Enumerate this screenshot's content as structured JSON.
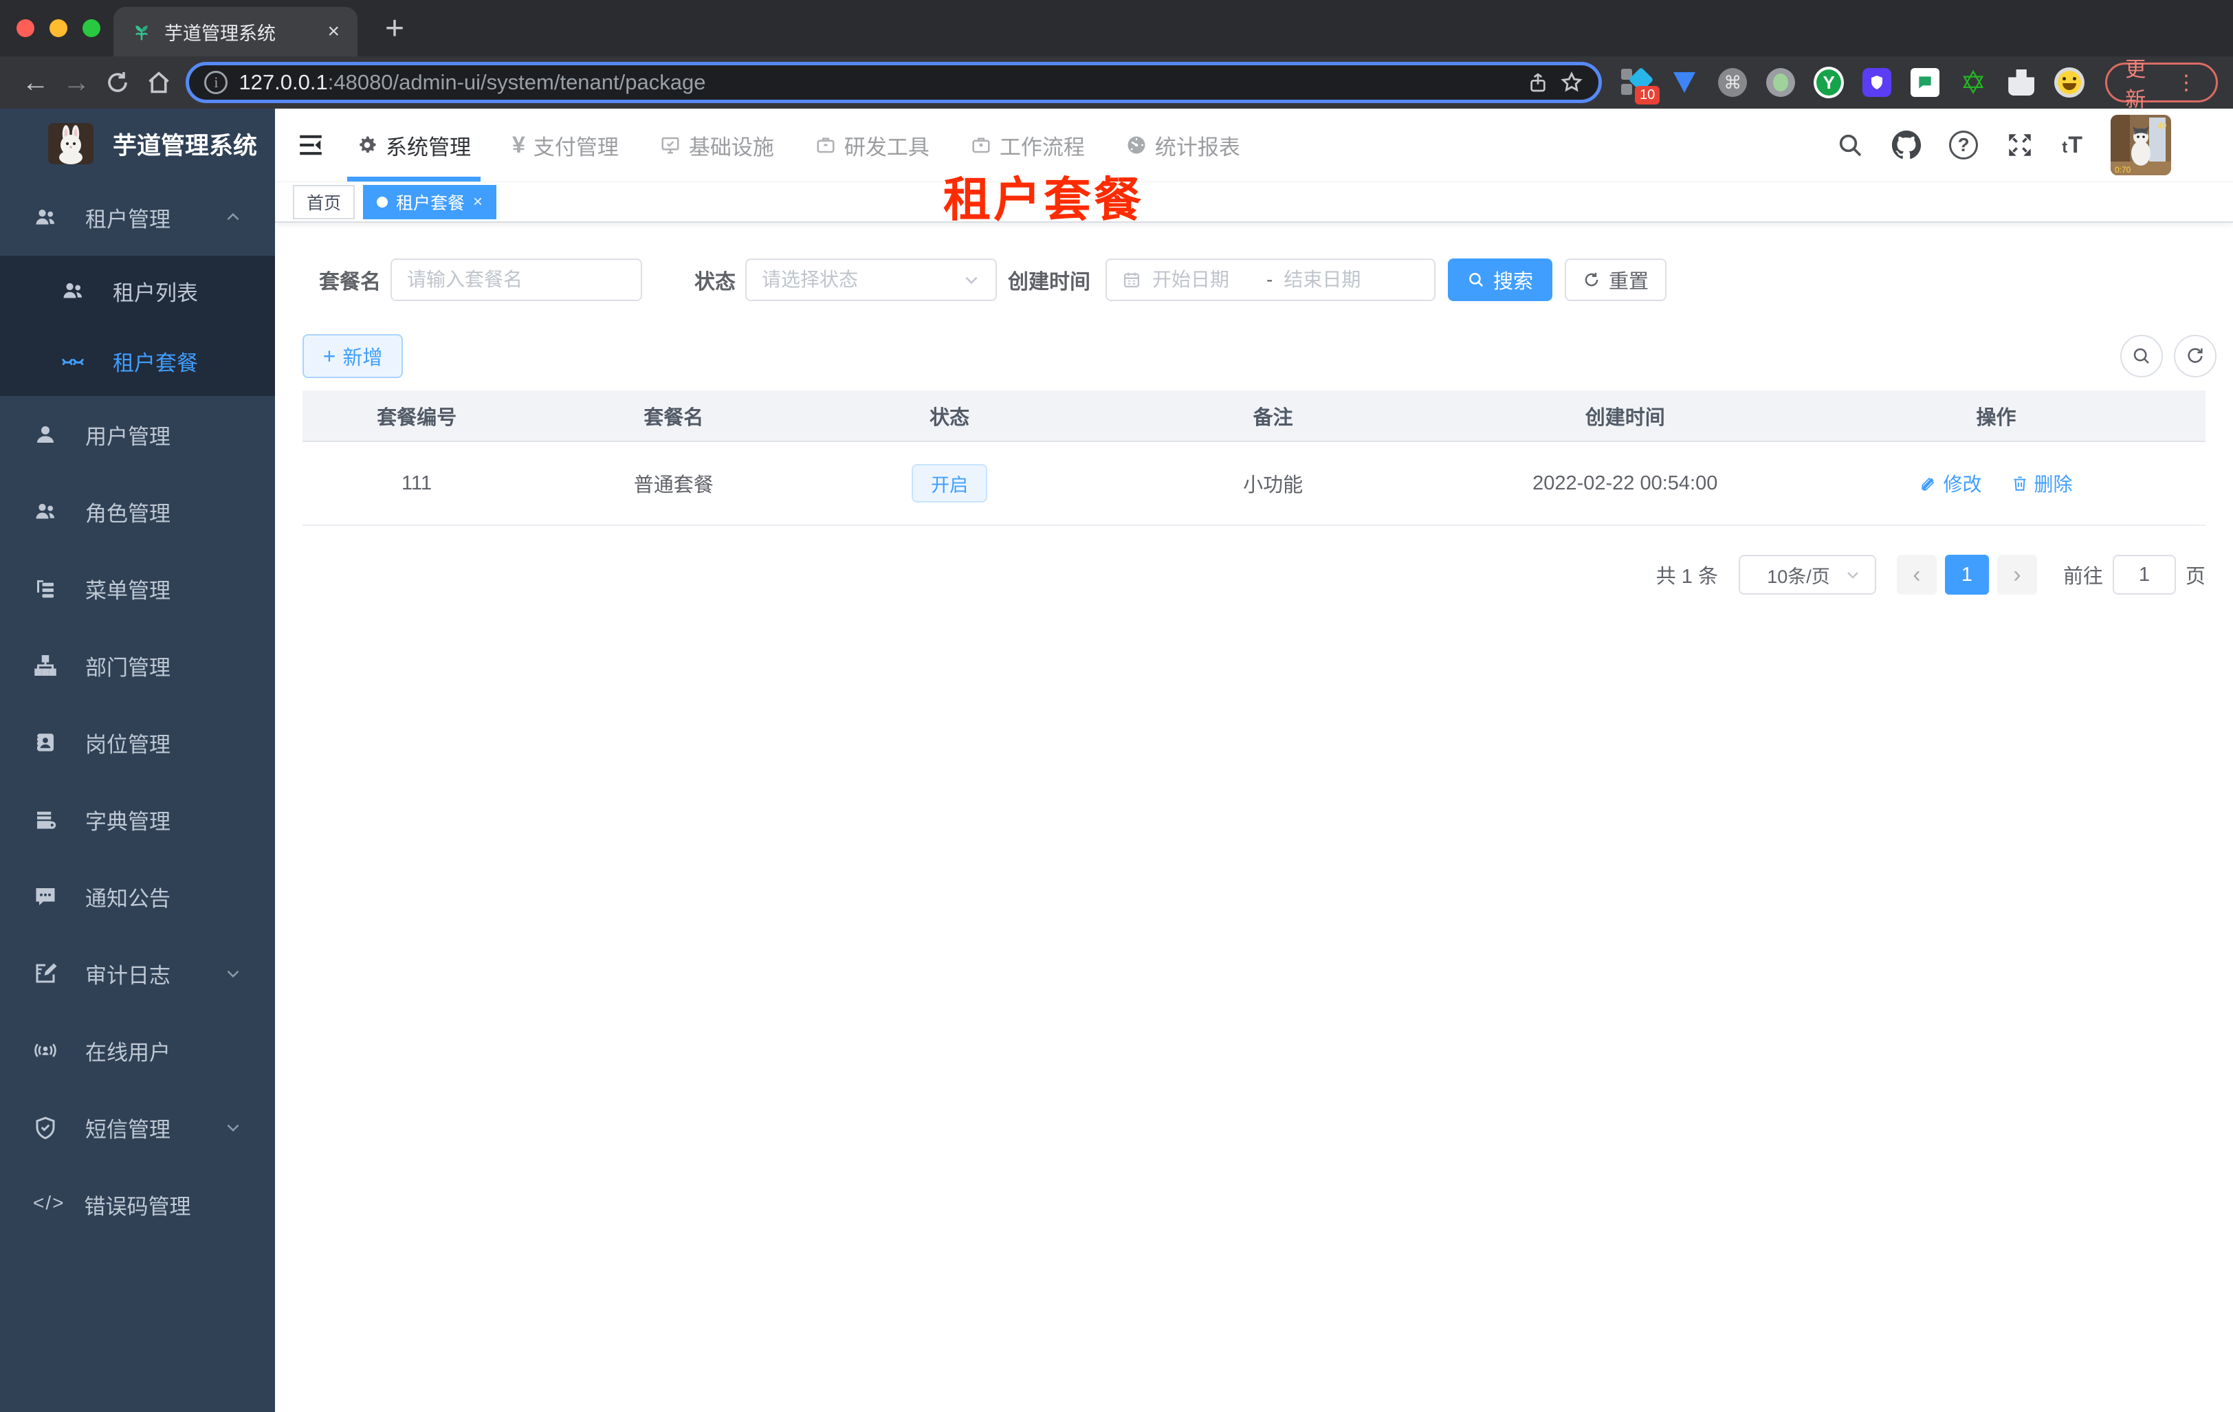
{
  "browser": {
    "tab_title": "芋道管理系统",
    "new_tab": "+",
    "tab_close": "×",
    "back": "←",
    "forward": "→",
    "url_host": "127.0.0.1",
    "url_path": ":48080/admin-ui/system/tenant/package",
    "extension_badge": "10",
    "update_button": "更新"
  },
  "sidebar": {
    "logo_title": "芋道管理系统",
    "items": [
      {
        "label": "租户管理",
        "icon": "users-icon",
        "state": "expanded"
      },
      {
        "label": "租户列表",
        "icon": "tenant-list-icon",
        "submenu": true
      },
      {
        "label": "租户套餐",
        "icon": "tenant-package-icon",
        "submenu": true,
        "active": true
      },
      {
        "label": "用户管理",
        "icon": "user-icon"
      },
      {
        "label": "角色管理",
        "icon": "roles-icon"
      },
      {
        "label": "菜单管理",
        "icon": "menu-tree-icon"
      },
      {
        "label": "部门管理",
        "icon": "org-chart-icon"
      },
      {
        "label": "岗位管理",
        "icon": "post-badge-icon"
      },
      {
        "label": "字典管理",
        "icon": "dictionary-icon"
      },
      {
        "label": "通知公告",
        "icon": "notice-icon"
      },
      {
        "label": "审计日志",
        "icon": "audit-log-icon",
        "state": "collapsed"
      },
      {
        "label": "在线用户",
        "icon": "online-user-icon"
      },
      {
        "label": "短信管理",
        "icon": "sms-shield-icon",
        "state": "collapsed"
      },
      {
        "label": "错误码管理",
        "icon": "error-code-icon",
        "icon_text": "</>"
      }
    ]
  },
  "topnav": {
    "items": [
      {
        "label": "系统管理",
        "icon": "gear-icon",
        "active": true
      },
      {
        "label": "支付管理",
        "icon": "yen-icon",
        "icon_text": "¥"
      },
      {
        "label": "基础设施",
        "icon": "monitor-icon"
      },
      {
        "label": "研发工具",
        "icon": "toolbox-icon"
      },
      {
        "label": "工作流程",
        "icon": "workflow-icon"
      },
      {
        "label": "统计报表",
        "icon": "dashboard-icon"
      }
    ],
    "font_size_icon_text": "tT"
  },
  "tags_view": {
    "tags": [
      {
        "label": "首页"
      },
      {
        "label": "租户套餐",
        "active": true,
        "close": "×"
      }
    ]
  },
  "page_overlay_title": "租户套餐",
  "filters": {
    "name_label": "套餐名",
    "name_placeholder": "请输入套餐名",
    "status_label": "状态",
    "status_placeholder": "请选择状态",
    "date_label": "创建时间",
    "date_start_placeholder": "开始日期",
    "date_separator": "-",
    "date_end_placeholder": "结束日期",
    "search_label": "搜索",
    "reset_label": "重置"
  },
  "toolbar": {
    "add_label": "新增",
    "plus": "+"
  },
  "table": {
    "headers": [
      "套餐编号",
      "套餐名",
      "状态",
      "备注",
      "创建时间",
      "操作"
    ],
    "rows": [
      {
        "id": "111",
        "name": "普通套餐",
        "status": "开启",
        "remark": "小功能",
        "created": "2022-02-22 00:54:00",
        "edit_label": "修改",
        "delete_label": "删除"
      }
    ]
  },
  "pagination": {
    "total": "共 1 条",
    "page_size": "10条/页",
    "prev": "‹",
    "next": "›",
    "current_page": "1",
    "goto_label": "前往",
    "goto_value": "1",
    "page_unit": "页"
  },
  "colors": {
    "primary": "#409eff",
    "overlay_red": "#fd2c00",
    "sidebar_bg": "#304156",
    "submenu_bg": "#202b3b",
    "status_tag_bg": "#ecf5ff"
  }
}
